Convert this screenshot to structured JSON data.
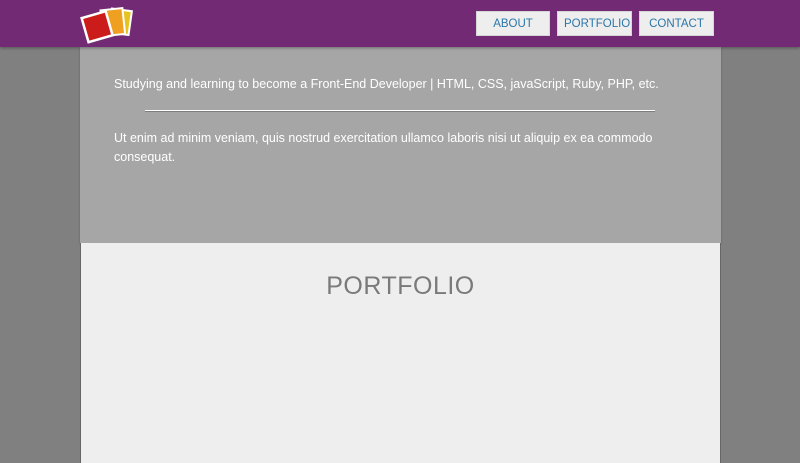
{
  "header": {
    "logo_icon": "overlapping-photos-logo",
    "nav": [
      {
        "label": "ABOUT"
      },
      {
        "label": "PORTFOLIO"
      },
      {
        "label": "CONTACT"
      }
    ]
  },
  "hero": {
    "tagline": "Studying and learning to become a Front-End Developer | HTML, CSS, javaScript, Ruby, PHP, etc.",
    "body": "Ut enim ad minim veniam, quis nostrud exercitation ullamco laboris nisi ut aliquip ex ea commodo consequat."
  },
  "portfolio": {
    "title": "PORTFOLIO"
  },
  "colors": {
    "header_bg": "#712a73",
    "page_bg": "#808080",
    "hero_bg": "#a6a6a6",
    "section_bg": "#eeeeee",
    "nav_text": "#2b76a8"
  }
}
